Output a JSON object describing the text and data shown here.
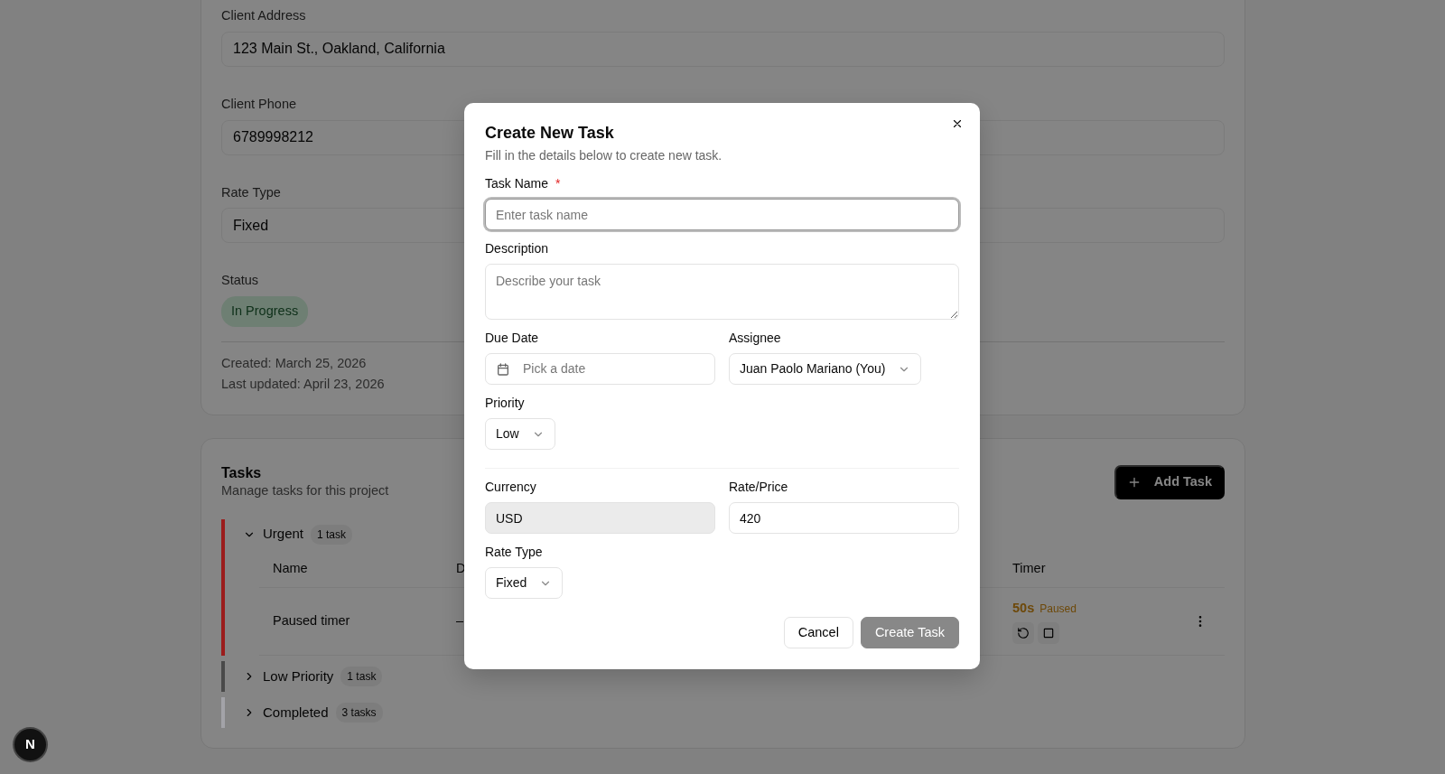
{
  "project_details": {
    "fields": [
      {
        "label": "Client Address",
        "value": "123 Main St., Oakland, California"
      },
      {
        "label": "Client Phone",
        "value": "6789998212"
      },
      {
        "label": "Rate Type",
        "value": "Fixed"
      }
    ],
    "status": {
      "label": "Status",
      "value": "In Progress"
    },
    "created": "Created: March 25, 2026",
    "last_updated": "Last updated: April 23, 2026"
  },
  "tasks_panel": {
    "title": "Tasks",
    "subtitle": "Manage tasks for this project",
    "add_button": "Add Task",
    "groups": [
      {
        "name": "Urgent",
        "count": "1 task",
        "expanded": true,
        "color": "#9b1c1c",
        "columns": [
          "Name",
          "D",
          "Timer"
        ],
        "rows": [
          {
            "name": "Paused timer",
            "column_2": "–",
            "timer": "50s",
            "timer_state": "Paused"
          }
        ]
      },
      {
        "name": "Low Priority",
        "count": "1 task",
        "expanded": false,
        "color": "#4a4a4a"
      },
      {
        "name": "Completed",
        "count": "3 tasks",
        "expanded": false,
        "color": "#a3a3a8"
      }
    ]
  },
  "dialog": {
    "title": "Create New Task",
    "subtitle": "Fill in the details below to create new task.",
    "task_name": {
      "label": "Task Name",
      "required_mark": "*",
      "placeholder": "Enter task name",
      "focused": true
    },
    "description": {
      "label": "Description",
      "placeholder": "Describe your task"
    },
    "due_date": {
      "label": "Due Date",
      "placeholder": "Pick a date"
    },
    "assignee": {
      "label": "Assignee",
      "value": "Juan Paolo Mariano (You)"
    },
    "priority": {
      "label": "Priority",
      "value": "Low"
    },
    "currency": {
      "label": "Currency",
      "value": "USD",
      "disabled": true
    },
    "rate_price": {
      "label": "Rate/Price",
      "value": "420"
    },
    "rate_type": {
      "label": "Rate Type",
      "value": "Fixed"
    },
    "buttons": [
      {
        "label": "Cancel",
        "kind": "secondary",
        "disabled": false
      },
      {
        "label": "Create Task",
        "kind": "primary",
        "disabled": true
      }
    ]
  },
  "dev_badge": "N"
}
